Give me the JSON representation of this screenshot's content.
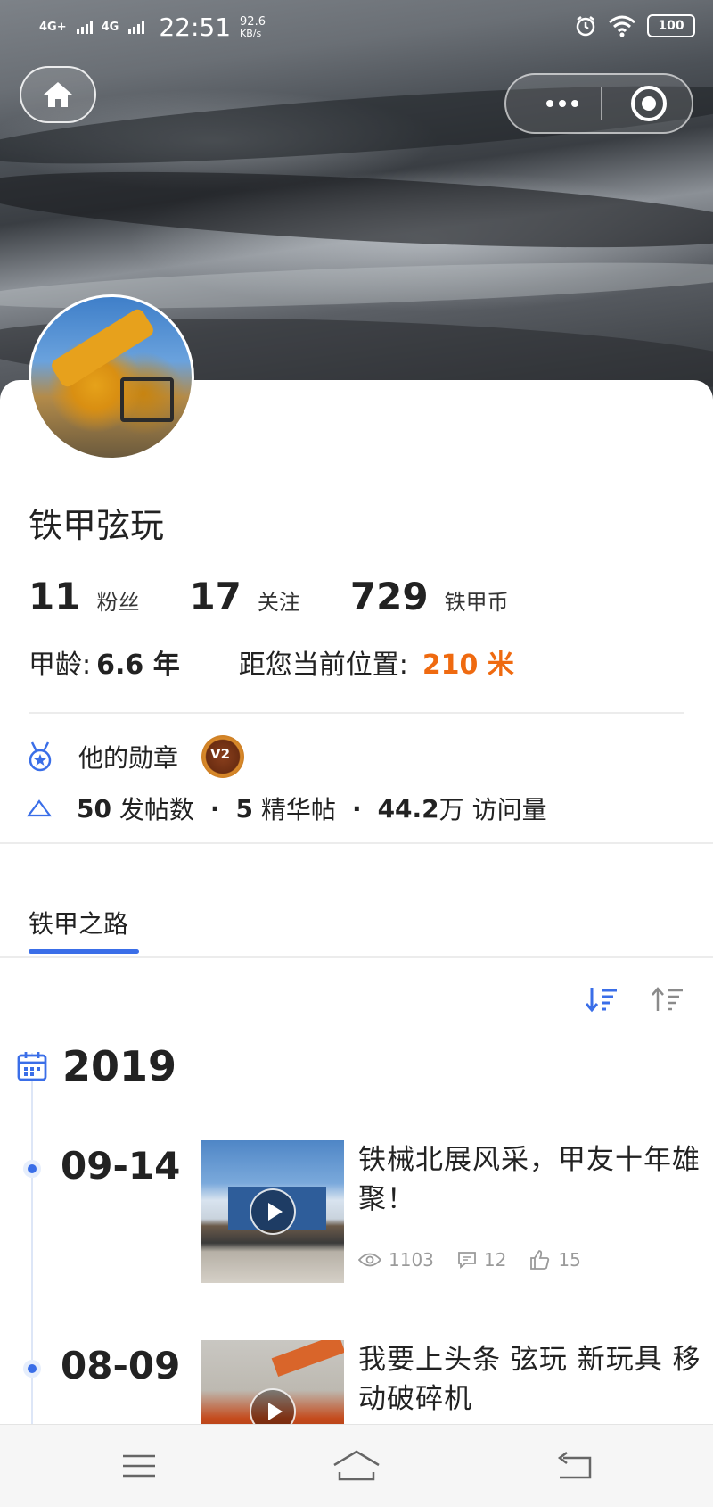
{
  "status_bar": {
    "network1": "4G+",
    "network2": "4G",
    "time": "22:51",
    "speed_value": "92.6",
    "speed_unit": "KB/s",
    "battery": "100"
  },
  "profile": {
    "username": "铁甲弦玩",
    "stats": [
      {
        "value": "11",
        "label": "粉丝"
      },
      {
        "value": "17",
        "label": "关注"
      },
      {
        "value": "729",
        "label": "铁甲币"
      }
    ],
    "age_label": "甲龄:",
    "age_value": "6.6 年",
    "distance_label": "距您当前位置:",
    "distance_value": "210 米",
    "medals_label": "他的勋章",
    "badge_text": "V2",
    "posts_count": "50",
    "posts_label": "发帖数",
    "featured_count": "5",
    "featured_label": "精华帖",
    "visits_count": "44.2",
    "visits_unit": "万",
    "visits_label": "访问量"
  },
  "tabs": {
    "active": "铁甲之路"
  },
  "timeline": {
    "year": "2019",
    "entries": [
      {
        "date": "09-14",
        "title": "铁械北展风采，甲友十年雄聚！",
        "views": "1103",
        "comments": "12",
        "likes": "15"
      },
      {
        "date": "08-09",
        "title": "我要上头条 弦玩 新玩具 移动破碎机"
      }
    ]
  },
  "colors": {
    "accent": "#3a6ee8",
    "distance": "#ef6a10"
  },
  "icons": [
    "home-icon",
    "more-icon",
    "record-icon",
    "medal-icon",
    "triangle-icon",
    "sort-desc-icon",
    "sort-asc-icon",
    "calendar-icon",
    "eye-icon",
    "comment-icon",
    "thumb-up-icon",
    "menu-icon",
    "home-nav-icon",
    "back-icon"
  ]
}
